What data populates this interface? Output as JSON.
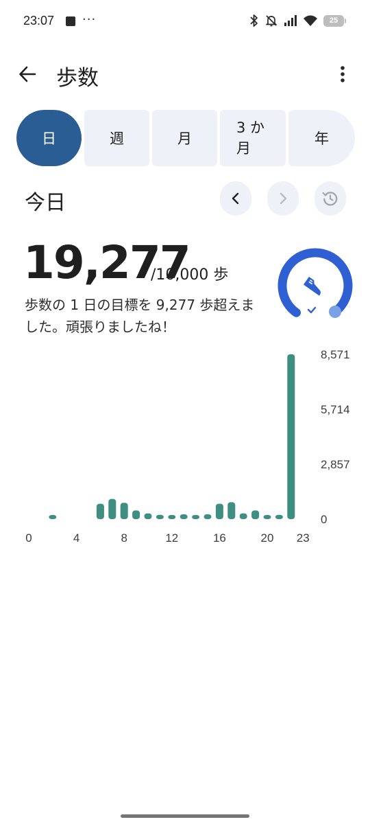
{
  "status_bar": {
    "time": "23:07",
    "more": "···",
    "battery_level": "25",
    "icons": [
      "bluetooth-icon",
      "silent-mode-icon",
      "cellular-signal-icon",
      "wifi-icon",
      "battery-icon"
    ]
  },
  "app_bar": {
    "title": "歩数",
    "back_icon": "arrow-back-icon",
    "menu_icon": "more-vertical-icon"
  },
  "range_tabs": [
    {
      "label": "日",
      "selected": true
    },
    {
      "label": "週",
      "selected": false
    },
    {
      "label": "月",
      "selected": false
    },
    {
      "label": "3 か月",
      "selected": false
    },
    {
      "label": "年",
      "selected": false
    }
  ],
  "period": {
    "label": "今日",
    "prev_icon": "chevron-left-icon",
    "next_icon": "chevron-right-icon",
    "reset_icon": "restore-icon"
  },
  "summary": {
    "steps": "19,277",
    "goal_text": "/10,000 歩",
    "message": "歩数の 1 日の目標を 9,277 歩超えました。頑張りましたね！"
  },
  "goal_ring": {
    "progress": 1.0,
    "icon": "sneaker-icon",
    "check_icon": "check-icon"
  },
  "colors": {
    "accent": "#2a5d94",
    "tab_bg": "#eef1f8",
    "bar": "#3f8e82",
    "ring": "#2f60d3",
    "ring_light": "#7aa0e6"
  },
  "chart_data": {
    "type": "bar",
    "x": [
      0,
      1,
      2,
      3,
      4,
      5,
      6,
      7,
      8,
      9,
      10,
      11,
      12,
      13,
      14,
      15,
      16,
      17,
      18,
      19,
      20,
      21,
      22,
      23
    ],
    "values": [
      0,
      0,
      20,
      0,
      0,
      0,
      800,
      1050,
      850,
      450,
      300,
      220,
      180,
      250,
      200,
      250,
      800,
      880,
      300,
      450,
      200,
      220,
      8571,
      0
    ],
    "x_tick_labels": [
      "0",
      "4",
      "8",
      "12",
      "16",
      "20",
      "23"
    ],
    "x_tick_positions": [
      0,
      4,
      8,
      12,
      16,
      20,
      23
    ],
    "y_tick_labels": [
      "8,571",
      "5,714",
      "2,857",
      "0"
    ],
    "y_tick_values": [
      8571,
      5714,
      2857,
      0
    ],
    "ylim": [
      0,
      8571
    ],
    "xlim": [
      0,
      23
    ]
  }
}
